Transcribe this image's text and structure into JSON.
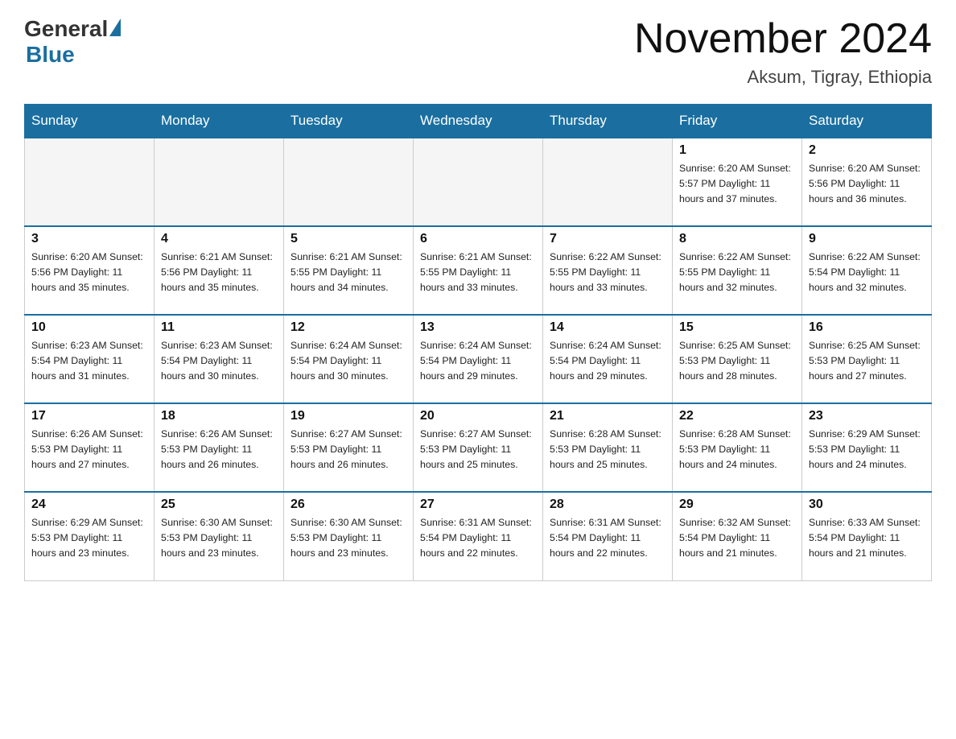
{
  "header": {
    "logo_general": "General",
    "logo_blue": "Blue",
    "month_title": "November 2024",
    "location": "Aksum, Tigray, Ethiopia"
  },
  "days_of_week": [
    "Sunday",
    "Monday",
    "Tuesday",
    "Wednesday",
    "Thursday",
    "Friday",
    "Saturday"
  ],
  "weeks": [
    [
      {
        "day": "",
        "info": ""
      },
      {
        "day": "",
        "info": ""
      },
      {
        "day": "",
        "info": ""
      },
      {
        "day": "",
        "info": ""
      },
      {
        "day": "",
        "info": ""
      },
      {
        "day": "1",
        "info": "Sunrise: 6:20 AM\nSunset: 5:57 PM\nDaylight: 11 hours\nand 37 minutes."
      },
      {
        "day": "2",
        "info": "Sunrise: 6:20 AM\nSunset: 5:56 PM\nDaylight: 11 hours\nand 36 minutes."
      }
    ],
    [
      {
        "day": "3",
        "info": "Sunrise: 6:20 AM\nSunset: 5:56 PM\nDaylight: 11 hours\nand 35 minutes."
      },
      {
        "day": "4",
        "info": "Sunrise: 6:21 AM\nSunset: 5:56 PM\nDaylight: 11 hours\nand 35 minutes."
      },
      {
        "day": "5",
        "info": "Sunrise: 6:21 AM\nSunset: 5:55 PM\nDaylight: 11 hours\nand 34 minutes."
      },
      {
        "day": "6",
        "info": "Sunrise: 6:21 AM\nSunset: 5:55 PM\nDaylight: 11 hours\nand 33 minutes."
      },
      {
        "day": "7",
        "info": "Sunrise: 6:22 AM\nSunset: 5:55 PM\nDaylight: 11 hours\nand 33 minutes."
      },
      {
        "day": "8",
        "info": "Sunrise: 6:22 AM\nSunset: 5:55 PM\nDaylight: 11 hours\nand 32 minutes."
      },
      {
        "day": "9",
        "info": "Sunrise: 6:22 AM\nSunset: 5:54 PM\nDaylight: 11 hours\nand 32 minutes."
      }
    ],
    [
      {
        "day": "10",
        "info": "Sunrise: 6:23 AM\nSunset: 5:54 PM\nDaylight: 11 hours\nand 31 minutes."
      },
      {
        "day": "11",
        "info": "Sunrise: 6:23 AM\nSunset: 5:54 PM\nDaylight: 11 hours\nand 30 minutes."
      },
      {
        "day": "12",
        "info": "Sunrise: 6:24 AM\nSunset: 5:54 PM\nDaylight: 11 hours\nand 30 minutes."
      },
      {
        "day": "13",
        "info": "Sunrise: 6:24 AM\nSunset: 5:54 PM\nDaylight: 11 hours\nand 29 minutes."
      },
      {
        "day": "14",
        "info": "Sunrise: 6:24 AM\nSunset: 5:54 PM\nDaylight: 11 hours\nand 29 minutes."
      },
      {
        "day": "15",
        "info": "Sunrise: 6:25 AM\nSunset: 5:53 PM\nDaylight: 11 hours\nand 28 minutes."
      },
      {
        "day": "16",
        "info": "Sunrise: 6:25 AM\nSunset: 5:53 PM\nDaylight: 11 hours\nand 27 minutes."
      }
    ],
    [
      {
        "day": "17",
        "info": "Sunrise: 6:26 AM\nSunset: 5:53 PM\nDaylight: 11 hours\nand 27 minutes."
      },
      {
        "day": "18",
        "info": "Sunrise: 6:26 AM\nSunset: 5:53 PM\nDaylight: 11 hours\nand 26 minutes."
      },
      {
        "day": "19",
        "info": "Sunrise: 6:27 AM\nSunset: 5:53 PM\nDaylight: 11 hours\nand 26 minutes."
      },
      {
        "day": "20",
        "info": "Sunrise: 6:27 AM\nSunset: 5:53 PM\nDaylight: 11 hours\nand 25 minutes."
      },
      {
        "day": "21",
        "info": "Sunrise: 6:28 AM\nSunset: 5:53 PM\nDaylight: 11 hours\nand 25 minutes."
      },
      {
        "day": "22",
        "info": "Sunrise: 6:28 AM\nSunset: 5:53 PM\nDaylight: 11 hours\nand 24 minutes."
      },
      {
        "day": "23",
        "info": "Sunrise: 6:29 AM\nSunset: 5:53 PM\nDaylight: 11 hours\nand 24 minutes."
      }
    ],
    [
      {
        "day": "24",
        "info": "Sunrise: 6:29 AM\nSunset: 5:53 PM\nDaylight: 11 hours\nand 23 minutes."
      },
      {
        "day": "25",
        "info": "Sunrise: 6:30 AM\nSunset: 5:53 PM\nDaylight: 11 hours\nand 23 minutes."
      },
      {
        "day": "26",
        "info": "Sunrise: 6:30 AM\nSunset: 5:53 PM\nDaylight: 11 hours\nand 23 minutes."
      },
      {
        "day": "27",
        "info": "Sunrise: 6:31 AM\nSunset: 5:54 PM\nDaylight: 11 hours\nand 22 minutes."
      },
      {
        "day": "28",
        "info": "Sunrise: 6:31 AM\nSunset: 5:54 PM\nDaylight: 11 hours\nand 22 minutes."
      },
      {
        "day": "29",
        "info": "Sunrise: 6:32 AM\nSunset: 5:54 PM\nDaylight: 11 hours\nand 21 minutes."
      },
      {
        "day": "30",
        "info": "Sunrise: 6:33 AM\nSunset: 5:54 PM\nDaylight: 11 hours\nand 21 minutes."
      }
    ]
  ]
}
